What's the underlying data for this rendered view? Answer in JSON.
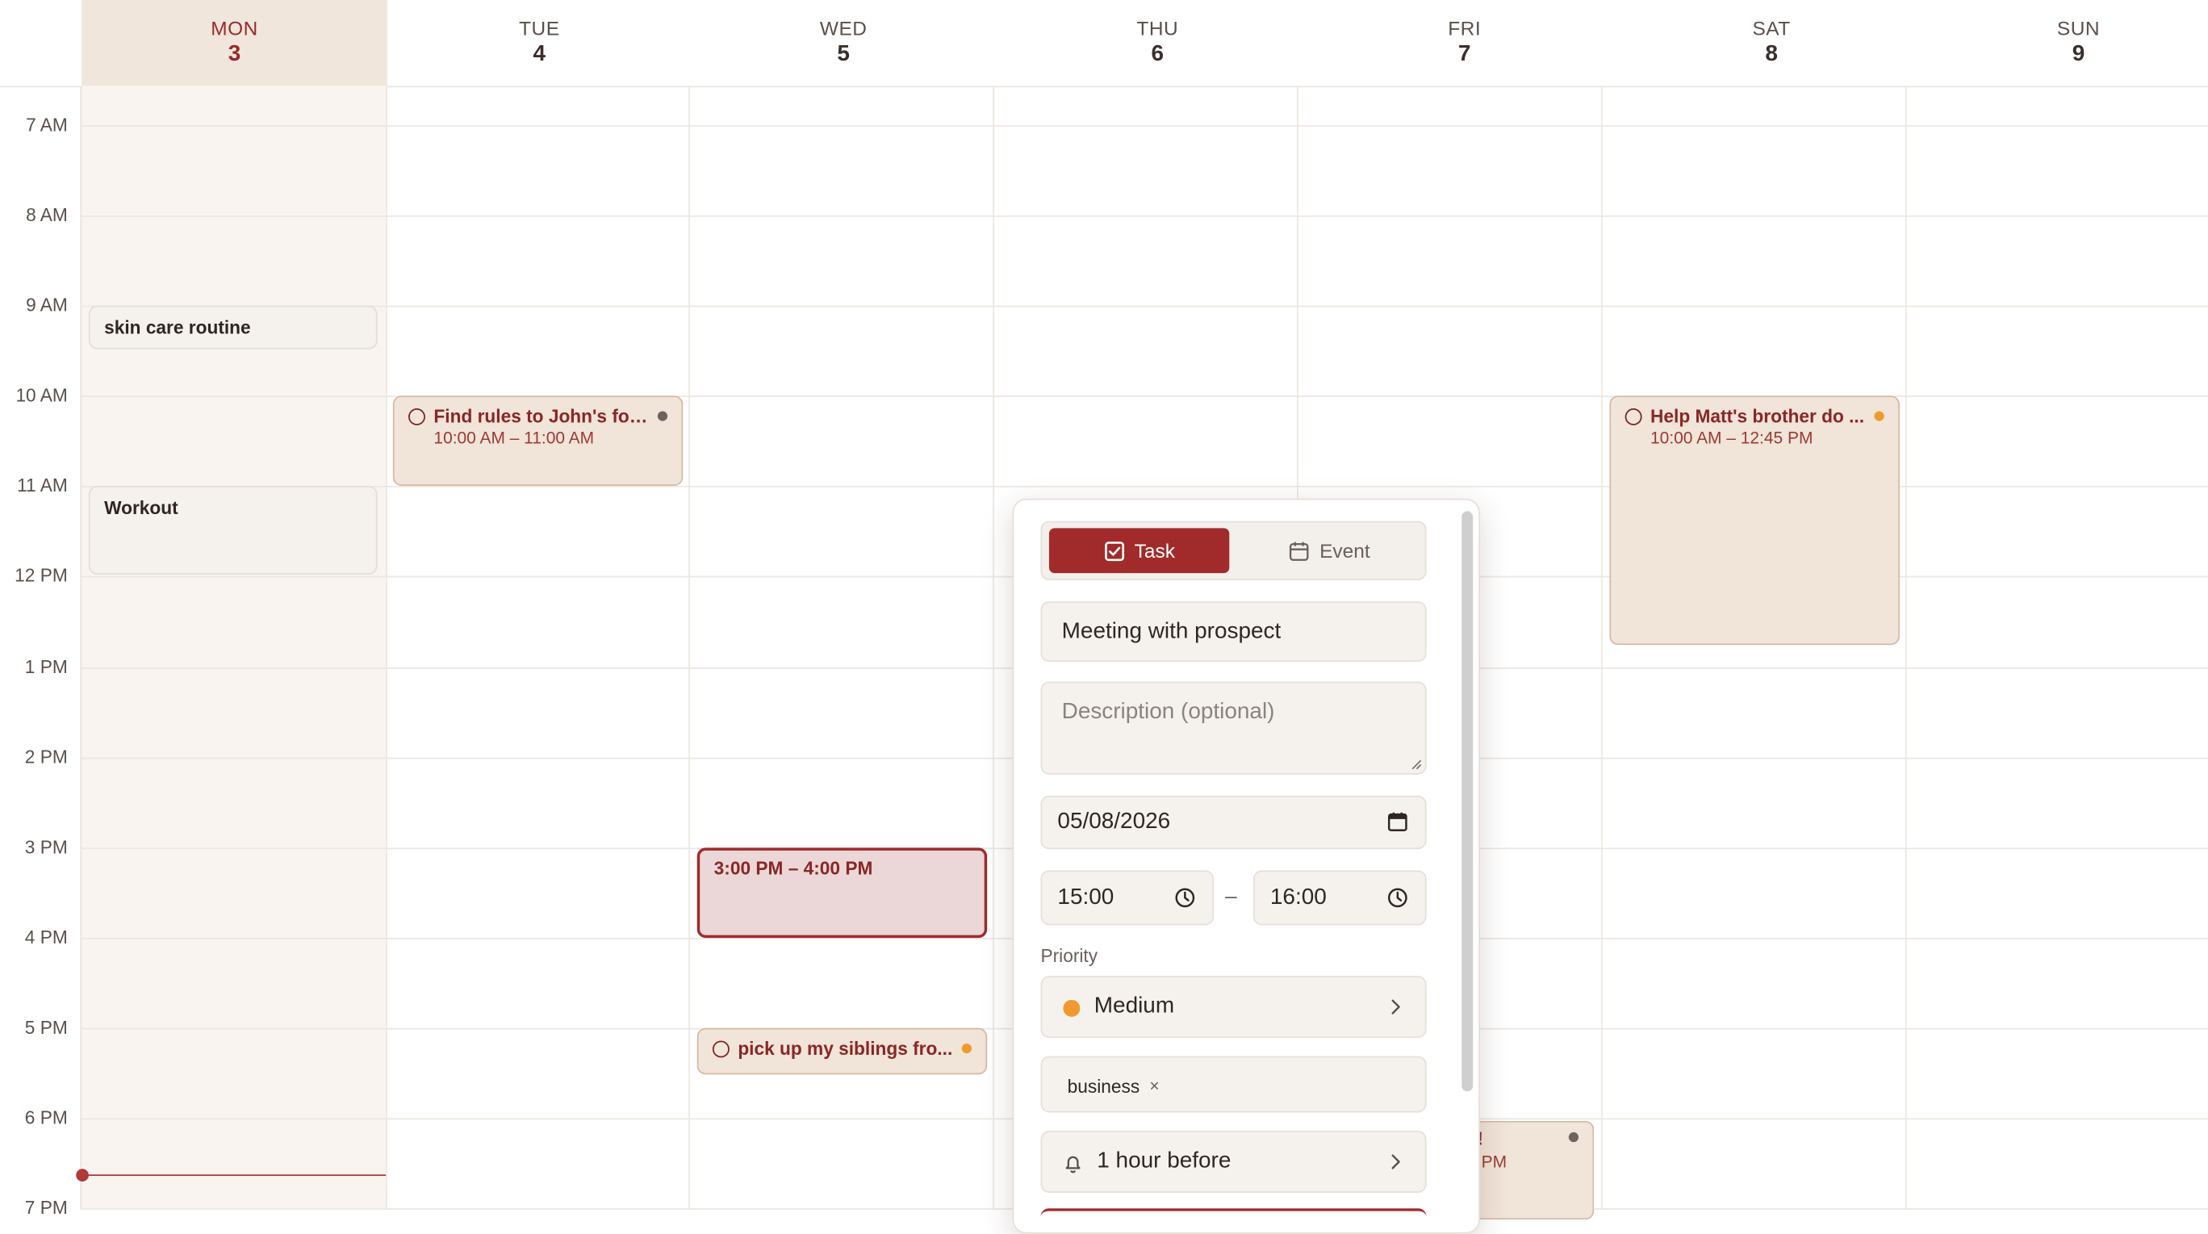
{
  "week": {
    "days": [
      {
        "name": "MON",
        "date": "3",
        "today": true
      },
      {
        "name": "TUE",
        "date": "4"
      },
      {
        "name": "WED",
        "date": "5"
      },
      {
        "name": "THU",
        "date": "6"
      },
      {
        "name": "FRI",
        "date": "7"
      },
      {
        "name": "SAT",
        "date": "8"
      },
      {
        "name": "SUN",
        "date": "9"
      }
    ],
    "hours": [
      "7 AM",
      "8 AM",
      "9 AM",
      "10 AM",
      "11 AM",
      "12 PM",
      "1 PM",
      "2 PM",
      "3 PM",
      "4 PM",
      "5 PM",
      "6 PM",
      "7 PM"
    ]
  },
  "events": {
    "skin_care": {
      "title": "skin care routine"
    },
    "workout": {
      "title": "Workout"
    },
    "john_rules": {
      "title": "Find rules to John's for...",
      "time": "10:00 AM – 11:00 AM",
      "dot_color": "#6d6460"
    },
    "matt_brother": {
      "title": "Help Matt's brother do ...",
      "time": "10:00 AM – 12:45 PM",
      "dot_color": "#ef9a2f"
    },
    "new_selection": {
      "time": "3:00 PM – 4:00 PM"
    },
    "siblings": {
      "title": "pick up my siblings fro...",
      "dot_color": "#ef9a2f"
    },
    "friday_partial": {
      "title": "!",
      "time": "PM",
      "dot_color": "#6d6460"
    }
  },
  "popup": {
    "task_label": "Task",
    "event_label": "Event",
    "title_value": "Meeting with prospect",
    "description_placeholder": "Description (optional)",
    "date_value": "05/08/2026",
    "start_time": "15:00",
    "end_time": "16:00",
    "time_separator": "–",
    "priority_label": "Priority",
    "priority_value": "Medium",
    "priority_color": "#ef9a2f",
    "tags": [
      {
        "label": "business"
      }
    ],
    "tag_remove": "×",
    "reminder_value": "1 hour before"
  },
  "colors": {
    "accent": "#a12b2b",
    "today_bg": "#f1e6db",
    "task_bg": "#f1e4d8",
    "priority_medium": "#ef9a2f"
  }
}
